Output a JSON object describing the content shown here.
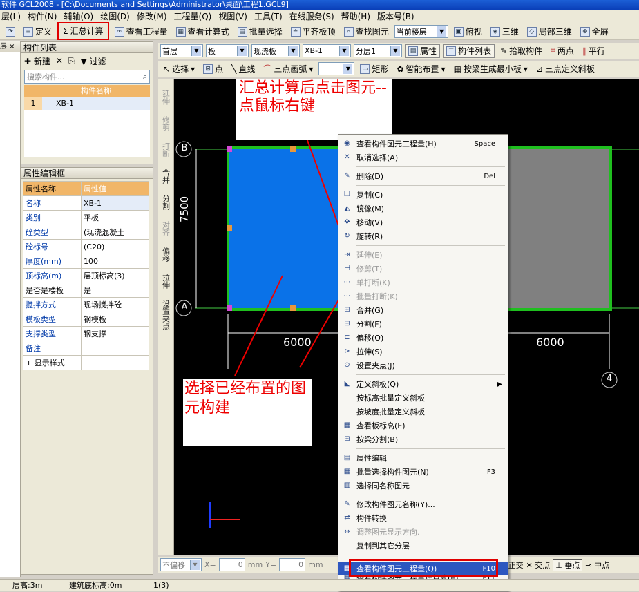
{
  "app": {
    "title": "软件 GCL2008 - [C:\\Documents and Settings\\Administrator\\桌面\\工程1.GCL9]"
  },
  "menu": [
    "层(L)",
    "构件(N)",
    "辅轴(O)",
    "绘图(D)",
    "修改(M)",
    "工程量(Q)",
    "视图(V)",
    "工具(T)",
    "在线服务(S)",
    "帮助(H)",
    "版本号(B)"
  ],
  "toolbar1": {
    "define": "定义",
    "sum_calc": "汇总计算",
    "view_qty": "查看工程量",
    "view_formula": "查看计算式",
    "batch_select": "批量选择",
    "flush_top": "平齐板顶",
    "find": "查找图元",
    "floor": "当前楼层",
    "view_mode": "俯视",
    "three_d": "三维",
    "local_3d": "局部三维",
    "full": "全屏"
  },
  "toolbar2": {
    "floor": "首层",
    "type": "板",
    "subtype": "现浇板",
    "member": "XB-1",
    "layer": "分层1",
    "property": "属性",
    "member_list": "构件列表",
    "pick": "拾取构件",
    "two_point": "两点",
    "parallel": "平行"
  },
  "toolbar3": {
    "select": "选择",
    "point": "点",
    "line": "直线",
    "arc": "三点画弧",
    "rect": "矩形",
    "smart": "智能布置",
    "beam_gen": "按梁生成最小板",
    "slope": "三点定义斜板"
  },
  "member_panel": {
    "title": "构件列表",
    "new_label": "新建",
    "filter_label": "过滤",
    "search_placeholder": "搜索构件...",
    "col_header": "构件名称",
    "rows": [
      {
        "idx": "1",
        "name": "XB-1"
      }
    ]
  },
  "prop_panel": {
    "title": "属性编辑框",
    "col_name": "属性名称",
    "col_value": "属性值",
    "rows": [
      {
        "k": "名称",
        "v": "XB-1"
      },
      {
        "k": "类别",
        "v": "平板"
      },
      {
        "k": "砼类型",
        "v": "(现浇混凝土"
      },
      {
        "k": "砼标号",
        "v": "(C20)"
      },
      {
        "k": "厚度(mm)",
        "v": "100"
      },
      {
        "k": "顶标高(m)",
        "v": "层顶标高(3)"
      },
      {
        "k": "是否是楼板",
        "v": "是"
      },
      {
        "k": "搅拌方式",
        "v": "现场搅拌砼"
      },
      {
        "k": "模板类型",
        "v": "钢模板"
      },
      {
        "k": "支撑类型",
        "v": "钢支撑"
      },
      {
        "k": "备注",
        "v": ""
      },
      {
        "k": "+ 显示样式",
        "v": ""
      }
    ]
  },
  "vtool": [
    "延伸",
    "修剪",
    "打断",
    "合并",
    "分割",
    "对齐",
    "偏移",
    "拉伸",
    "设置夹点"
  ],
  "canvas": {
    "axis_b": "B",
    "axis_a": "A",
    "axis_4": "4",
    "dim_left": "7500",
    "dim_bottom1": "6000",
    "dim_bottom2": "6000",
    "note_top": "汇总计算后点击图元--点鼠标右键",
    "note_bottom": "选择已经布置的图元构建"
  },
  "context_menu": [
    {
      "label": "查看构件图元工程量(H)",
      "sc": "Space"
    },
    {
      "label": "取消选择(A)"
    },
    {
      "sep": true
    },
    {
      "label": "删除(D)",
      "sc": "Del"
    },
    {
      "sep": true
    },
    {
      "label": "复制(C)"
    },
    {
      "label": "镜像(M)"
    },
    {
      "label": "移动(V)"
    },
    {
      "label": "旋转(R)"
    },
    {
      "sep": true
    },
    {
      "label": "延伸(E)",
      "dis": true
    },
    {
      "label": "修剪(T)",
      "dis": true
    },
    {
      "label": "单打断(K)",
      "dis": true
    },
    {
      "label": "批量打断(K)",
      "dis": true
    },
    {
      "label": "合并(G)"
    },
    {
      "label": "分割(F)"
    },
    {
      "label": "偏移(O)"
    },
    {
      "label": "拉伸(S)"
    },
    {
      "label": "设置夹点(J)"
    },
    {
      "sep": true
    },
    {
      "label": "定义斜板(Q)",
      "sub": true
    },
    {
      "label": "按标高批量定义斜板"
    },
    {
      "label": "按坡度批量定义斜板"
    },
    {
      "label": "查看板标高(E)"
    },
    {
      "label": "按梁分割(B)"
    },
    {
      "sep": true
    },
    {
      "label": "属性编辑"
    },
    {
      "label": "批量选择构件图元(N)",
      "sc": "F3"
    },
    {
      "label": "选择同名称图元"
    },
    {
      "sep": true
    },
    {
      "label": "修改构件图元名称(Y)..."
    },
    {
      "label": "构件转换"
    },
    {
      "label": "调整图元显示方向.",
      "dis": true
    },
    {
      "label": "复制到其它分层"
    },
    {
      "sep": true
    },
    {
      "label": "查看构件图元工程量(Q)",
      "sc": "F10",
      "hl": true
    },
    {
      "label": "查看构件图元工程量计算式(E)",
      "sc": "F11"
    }
  ],
  "snapbar": {
    "offset": "不偏移",
    "x": "X=",
    "y": "Y=",
    "xv": "0",
    "yv": "0",
    "mm": "mm",
    "ortho": "正交",
    "intersect": "交点",
    "perp": "垂点",
    "mid": "中点"
  },
  "status": {
    "floor_height": "层高:3m",
    "base_elev": "建筑底标高:0m",
    "count": "1(3)"
  }
}
